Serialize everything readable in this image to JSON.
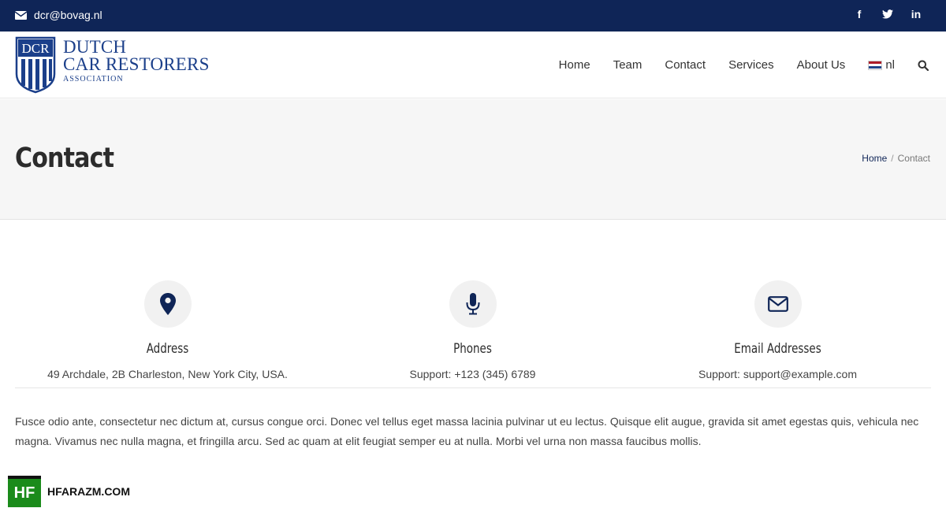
{
  "topbar": {
    "email": "dcr@bovag.nl",
    "social": [
      {
        "icon": "facebook-icon",
        "glyph": "f"
      },
      {
        "icon": "twitter-icon",
        "glyph": "ᵛ"
      },
      {
        "icon": "linkedin-icon",
        "glyph": "in"
      }
    ]
  },
  "logo": {
    "shield_text": "DCR",
    "line1": "DUTCH",
    "line2": "CAR RESTORERS",
    "line3": "ASSOCIATION"
  },
  "nav": {
    "items": [
      "Home",
      "Team",
      "Contact",
      "Services",
      "About Us"
    ],
    "lang": "nl"
  },
  "page": {
    "title": "Contact",
    "breadcrumb": {
      "home": "Home",
      "sep": "/",
      "current": "Contact"
    }
  },
  "cards": [
    {
      "icon": "map-pin-icon",
      "title": "Address",
      "info": "49 Archdale, 2B Charleston, New York City, USA."
    },
    {
      "icon": "microphone-icon",
      "title": "Phones",
      "info": "Support: +123 (345) 6789"
    },
    {
      "icon": "envelope-icon",
      "title": "Email Addresses",
      "info": "Support: support@example.com"
    }
  ],
  "lead": "Fusce odio ante, consectetur nec dictum at, cursus congue orci. Donec vel tellus eget massa lacinia pulvinar ut eu lectus. Quisque elit augue, gravida sit amet egestas quis, vehicula nec magna. Vivamus nec nulla magna, et fringilla arcu. Sed ac quam at elit feugiat semper eu at nulla. Morbi vel urna non massa faucibus mollis.",
  "watermark": {
    "badge": "HF",
    "text": "HFARAZM.COM"
  },
  "colors": {
    "topbar": "#0f2557",
    "brand": "#1b3f8a",
    "watermark": "#1b8b1b"
  }
}
